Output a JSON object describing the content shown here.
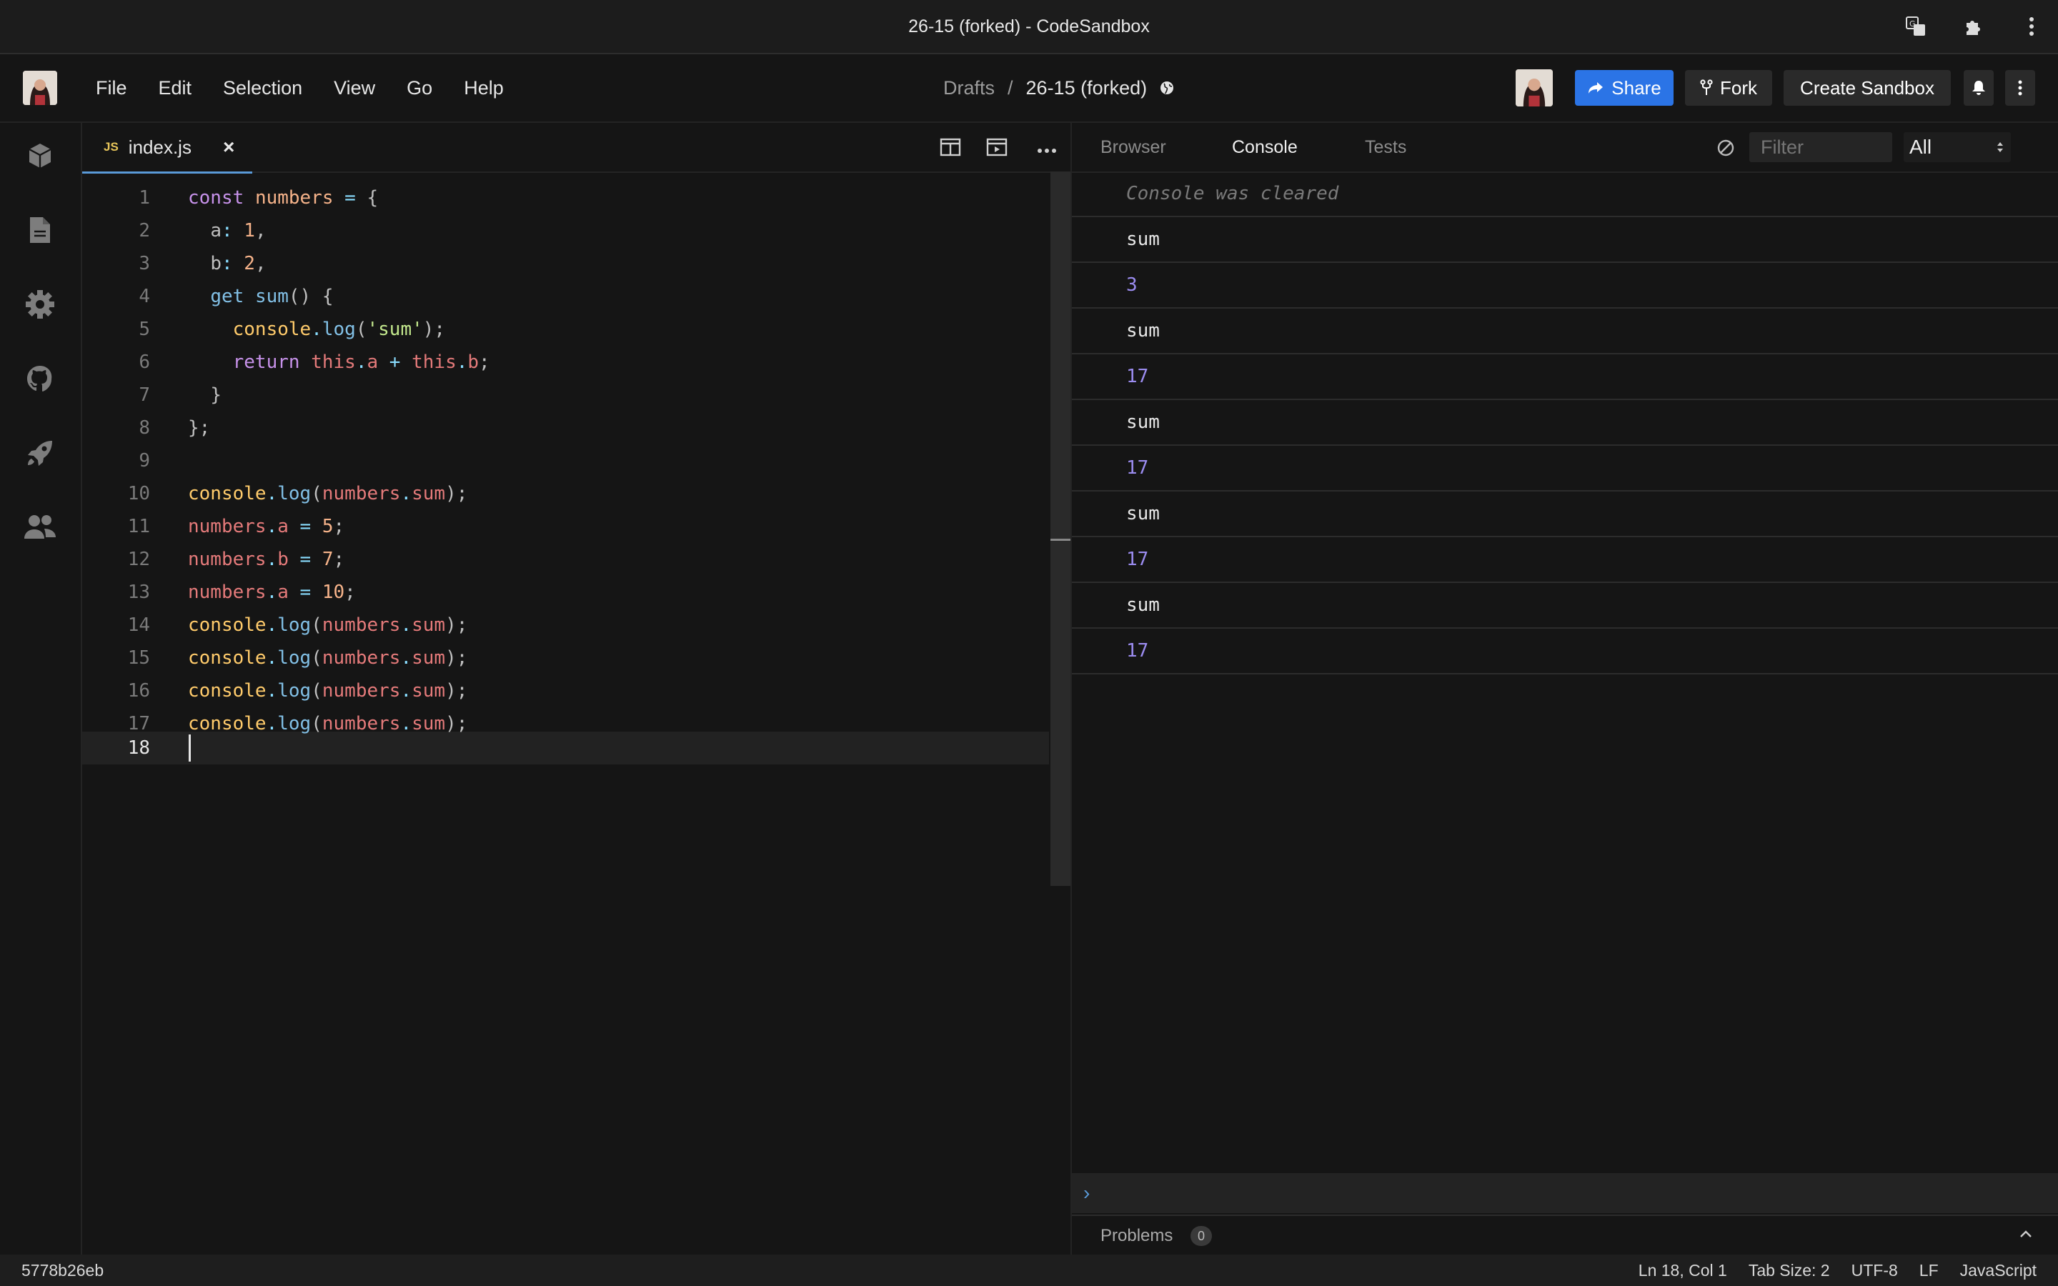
{
  "window": {
    "title": "26-15 (forked) - CodeSandbox"
  },
  "menu": [
    "File",
    "Edit",
    "Selection",
    "View",
    "Go",
    "Help"
  ],
  "breadcrumb": {
    "parent": "Drafts",
    "separator": "/",
    "current": "26-15 (forked)"
  },
  "actions": {
    "share": "Share",
    "fork": "Fork",
    "create": "Create Sandbox"
  },
  "editor": {
    "tab": {
      "badge": "JS",
      "filename": "index.js",
      "close": "×"
    },
    "lines": [
      {
        "n": "1"
      },
      {
        "n": "2"
      },
      {
        "n": "3"
      },
      {
        "n": "4"
      },
      {
        "n": "5"
      },
      {
        "n": "6"
      },
      {
        "n": "7"
      },
      {
        "n": "8"
      },
      {
        "n": "9"
      },
      {
        "n": "10"
      },
      {
        "n": "11"
      },
      {
        "n": "12"
      },
      {
        "n": "13"
      },
      {
        "n": "14"
      },
      {
        "n": "15"
      },
      {
        "n": "16"
      },
      {
        "n": "17"
      },
      {
        "n": "18"
      }
    ],
    "code": {
      "const": "const",
      "numbers": "numbers",
      "eq": "=",
      "lbrace": "{",
      "a": "a",
      "one": "1",
      "b": "b",
      "two": "2",
      "colon": ":",
      "comma": ",",
      "get": "get",
      "sum": "sum",
      "parens": "()",
      "console": "console",
      "dot": ".",
      "log": "log",
      "sumstr": "'sum'",
      "return": "return",
      "this": "this",
      "plus": "+",
      "rbrace": "}",
      "rbrace_semi": "};",
      "open": "(",
      "close_semi": ");",
      "semi": ";",
      "five": "5",
      "seven": "7",
      "ten": "10"
    }
  },
  "preview": {
    "tabs": [
      "Browser",
      "Console",
      "Tests"
    ],
    "active_tab": "Console",
    "filter_placeholder": "Filter",
    "level": "All",
    "cleared": "Console was cleared",
    "logs": [
      "sum",
      "3",
      "sum",
      "17",
      "sum",
      "17",
      "sum",
      "17",
      "sum",
      "17"
    ],
    "prompt": "›",
    "problems_label": "Problems",
    "problems_count": "0"
  },
  "status": {
    "commit": "5778b26eb",
    "position": "Ln 18, Col 1",
    "tab_size": "Tab Size: 2",
    "encoding": "UTF-8",
    "eol": "LF",
    "language": "JavaScript"
  },
  "colors": {
    "accent": "#2b74e6",
    "number": "#9b8cf0",
    "bg": "#151515"
  }
}
